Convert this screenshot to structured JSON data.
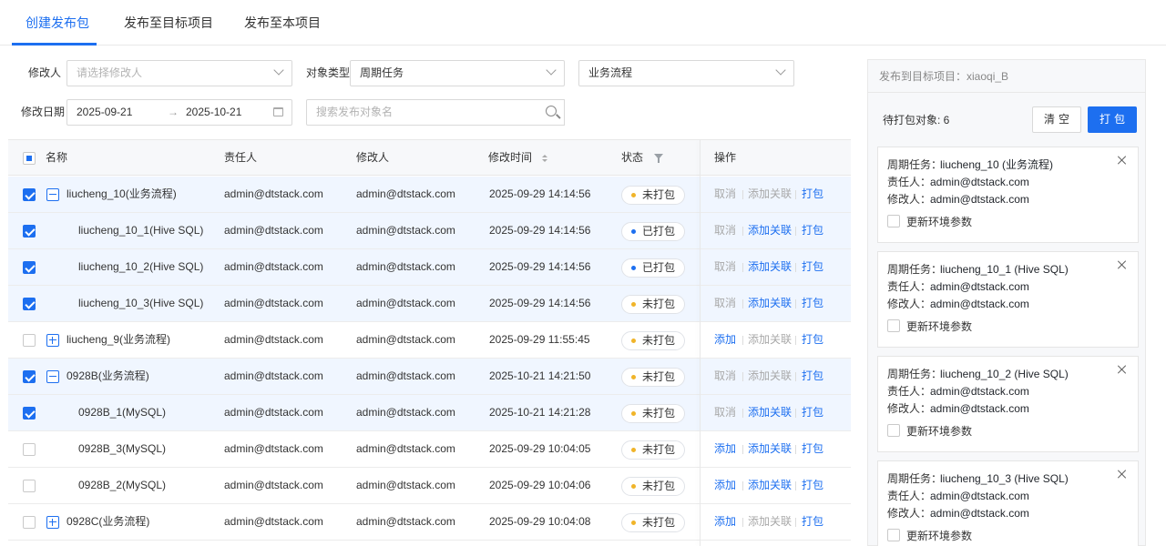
{
  "tabs": [
    {
      "label": "创建发布包",
      "active": true
    },
    {
      "label": "发布至目标项目",
      "active": false
    },
    {
      "label": "发布至本项目",
      "active": false
    }
  ],
  "filters": {
    "modifier_label": "修改人",
    "modifier_placeholder": "请选择修改人",
    "object_type_label": "对象类型",
    "object_type_value": "周期任务",
    "object_subtype_value": "业务流程",
    "date_label": "修改日期",
    "date_start": "2025-09-21",
    "date_arrow": "→",
    "date_end": "2025-10-21",
    "search_placeholder": "搜索发布对象名"
  },
  "table": {
    "headers": {
      "name": "名称",
      "owner": "责任人",
      "modifier": "修改人",
      "modified_time": "修改时间",
      "status": "状态",
      "ops": "操作"
    },
    "rows": [
      {
        "name": "liucheng_10(业务流程)",
        "owner": "admin@dtstack.com",
        "modifier": "admin@dtstack.com",
        "time": "2025-09-29 14:14:56",
        "status": "未打包",
        "op1": "取消",
        "op2": "添加关联",
        "op3": "打包"
      },
      {
        "name": "liucheng_10_1(Hive SQL)",
        "owner": "admin@dtstack.com",
        "modifier": "admin@dtstack.com",
        "time": "2025-09-29 14:14:56",
        "status": "已打包",
        "op1": "取消",
        "op2": "添加关联",
        "op3": "打包"
      },
      {
        "name": "liucheng_10_2(Hive SQL)",
        "owner": "admin@dtstack.com",
        "modifier": "admin@dtstack.com",
        "time": "2025-09-29 14:14:56",
        "status": "已打包",
        "op1": "取消",
        "op2": "添加关联",
        "op3": "打包"
      },
      {
        "name": "liucheng_10_3(Hive SQL)",
        "owner": "admin@dtstack.com",
        "modifier": "admin@dtstack.com",
        "time": "2025-09-29 14:14:56",
        "status": "未打包",
        "op1": "取消",
        "op2": "添加关联",
        "op3": "打包"
      },
      {
        "name": "liucheng_9(业务流程)",
        "owner": "admin@dtstack.com",
        "modifier": "admin@dtstack.com",
        "time": "2025-09-29 11:55:45",
        "status": "未打包",
        "op1": "添加",
        "op2": "添加关联",
        "op3": "打包"
      },
      {
        "name": "0928B(业务流程)",
        "owner": "admin@dtstack.com",
        "modifier": "admin@dtstack.com",
        "time": "2025-10-21 14:21:50",
        "status": "未打包",
        "op1": "取消",
        "op2": "添加关联",
        "op3": "打包"
      },
      {
        "name": "0928B_1(MySQL)",
        "owner": "admin@dtstack.com",
        "modifier": "admin@dtstack.com",
        "time": "2025-10-21 14:21:28",
        "status": "未打包",
        "op1": "取消",
        "op2": "添加关联",
        "op3": "打包"
      },
      {
        "name": "0928B_3(MySQL)",
        "owner": "admin@dtstack.com",
        "modifier": "admin@dtstack.com",
        "time": "2025-09-29 10:04:05",
        "status": "未打包",
        "op1": "添加",
        "op2": "添加关联",
        "op3": "打包"
      },
      {
        "name": "0928B_2(MySQL)",
        "owner": "admin@dtstack.com",
        "modifier": "admin@dtstack.com",
        "time": "2025-09-29 10:04:06",
        "status": "未打包",
        "op1": "添加",
        "op2": "添加关联",
        "op3": "打包"
      },
      {
        "name": "0928C(业务流程)",
        "owner": "admin@dtstack.com",
        "modifier": "admin@dtstack.com",
        "time": "2025-09-29 10:04:08",
        "status": "未打包",
        "op1": "添加",
        "op2": "添加关联",
        "op3": "打包"
      }
    ]
  },
  "panel": {
    "target_label": "发布到目标项目：xiaoqi_B",
    "pending_label": "待打包对象: 6",
    "clear_label": "清空",
    "pack_label": "打包",
    "key_task": "周期任务：",
    "key_owner": "责任人：",
    "key_modifier": "修改人：",
    "env_label": "更新环境参数",
    "cards": [
      {
        "task": "liucheng_10 (业务流程)",
        "owner": "admin@dtstack.com",
        "modifier": "admin@dtstack.com"
      },
      {
        "task": "liucheng_10_1 (Hive SQL)",
        "owner": "admin@dtstack.com",
        "modifier": "admin@dtstack.com"
      },
      {
        "task": "liucheng_10_2 (Hive SQL)",
        "owner": "admin@dtstack.com",
        "modifier": "admin@dtstack.com"
      },
      {
        "task": "liucheng_10_3 (Hive SQL)",
        "owner": "admin@dtstack.com",
        "modifier": "admin@dtstack.com"
      }
    ]
  },
  "colors": {
    "accent": "#1d6ff0",
    "status_packed": "#1d6ff0",
    "status_unpacked": "#f0b429"
  }
}
